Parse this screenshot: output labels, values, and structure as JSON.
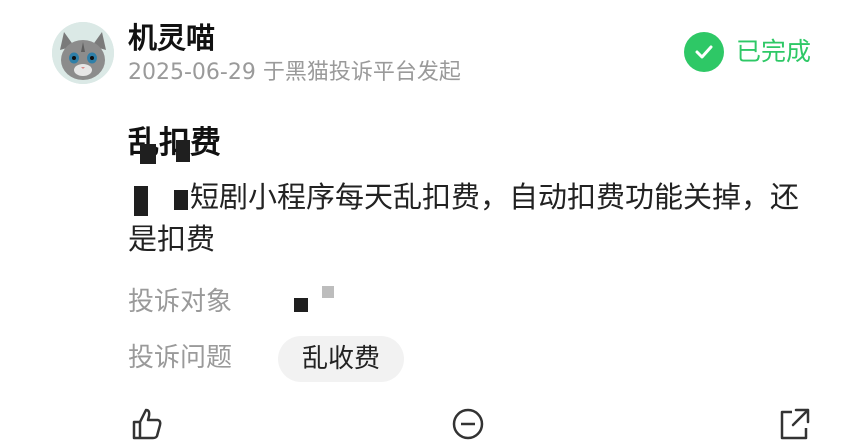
{
  "post": {
    "username": "机灵喵",
    "meta": "2025-06-29 于黑猫投诉平台发起",
    "status": "已完成",
    "title": "乱扣费",
    "body": "短剧小程序每天乱扣费，自动扣费功能关掉，还是扣费",
    "target_label": "投诉对象",
    "issue_label": "投诉问题",
    "issue_tag": "乱收费"
  },
  "colors": {
    "status_green": "#2ec866",
    "muted_text": "#9a9a9a",
    "tag_bg": "#f2f2f2"
  },
  "icons": {
    "avatar": "gray-cat-avatar",
    "status": "check-circle-icon",
    "like": "thumb-up-icon",
    "comment": "comment-icon",
    "share": "share-icon"
  }
}
